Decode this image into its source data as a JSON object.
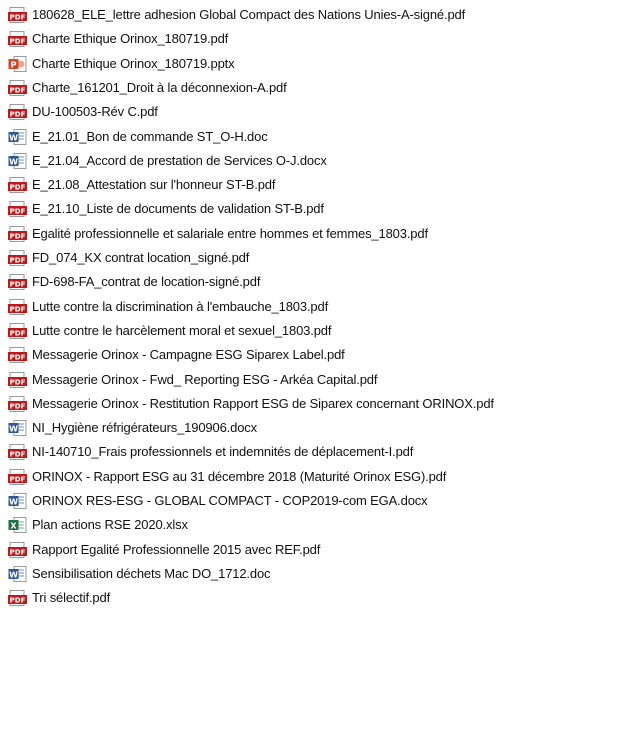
{
  "colors": {
    "pdf": "#b91c1c",
    "word": "#2b5797",
    "powerpoint": "#d24726",
    "excel": "#1d7044",
    "text": "#111111",
    "background": "#ffffff"
  },
  "files": [
    {
      "name": "180628_ELE_lettre adhesion Global Compact des Nations Unies-A-signé.pdf",
      "type": "pdf",
      "icon": "pdf-icon"
    },
    {
      "name": "Charte Ethique Orinox_180719.pdf",
      "type": "pdf",
      "icon": "pdf-icon"
    },
    {
      "name": "Charte Ethique Orinox_180719.pptx",
      "type": "pptx",
      "icon": "powerpoint-icon"
    },
    {
      "name": "Charte_161201_Droit à la déconnexion-A.pdf",
      "type": "pdf",
      "icon": "pdf-icon"
    },
    {
      "name": "DU-100503-Rév C.pdf",
      "type": "pdf",
      "icon": "pdf-icon"
    },
    {
      "name": "E_21.01_Bon de commande ST_O-H.doc",
      "type": "doc",
      "icon": "word-icon"
    },
    {
      "name": "E_21.04_Accord de prestation de Services O-J.docx",
      "type": "docx",
      "icon": "word-icon"
    },
    {
      "name": "E_21.08_Attestation sur l'honneur ST-B.pdf",
      "type": "pdf",
      "icon": "pdf-icon"
    },
    {
      "name": "E_21.10_Liste de  documents de validation ST-B.pdf",
      "type": "pdf",
      "icon": "pdf-icon"
    },
    {
      "name": "Egalité professionnelle et salariale entre hommes et femmes_1803.pdf",
      "type": "pdf",
      "icon": "pdf-icon"
    },
    {
      "name": "FD_074_KX contrat location_signé.pdf",
      "type": "pdf",
      "icon": "pdf-icon"
    },
    {
      "name": "FD-698-FA_contrat de location-signé.pdf",
      "type": "pdf",
      "icon": "pdf-icon"
    },
    {
      "name": "Lutte contre la discrimination à l'embauche_1803.pdf",
      "type": "pdf",
      "icon": "pdf-icon"
    },
    {
      "name": "Lutte contre le harcèlement moral et sexuel_1803.pdf",
      "type": "pdf",
      "icon": "pdf-icon"
    },
    {
      "name": "Messagerie Orinox - Campagne ESG Siparex Label.pdf",
      "type": "pdf",
      "icon": "pdf-icon"
    },
    {
      "name": "Messagerie Orinox - Fwd_ Reporting ESG - Arkéa Capital.pdf",
      "type": "pdf",
      "icon": "pdf-icon"
    },
    {
      "name": "Messagerie Orinox - Restitution Rapport ESG de Siparex concernant ORINOX.pdf",
      "type": "pdf",
      "icon": "pdf-icon"
    },
    {
      "name": "NI_Hygiène réfrigérateurs_190906.docx",
      "type": "docx",
      "icon": "word-icon"
    },
    {
      "name": "NI-140710_Frais professionnels et indemnités de déplacement-I.pdf",
      "type": "pdf",
      "icon": "pdf-icon"
    },
    {
      "name": "ORINOX - Rapport ESG au 31 décembre 2018 (Maturité Orinox ESG).pdf",
      "type": "pdf",
      "icon": "pdf-icon"
    },
    {
      "name": "ORINOX RES-ESG - GLOBAL COMPACT - COP2019-com EGA.docx",
      "type": "docx",
      "icon": "word-icon"
    },
    {
      "name": "Plan actions RSE 2020.xlsx",
      "type": "xlsx",
      "icon": "excel-icon"
    },
    {
      "name": "Rapport Egalité Professionnelle 2015 avec REF.pdf",
      "type": "pdf",
      "icon": "pdf-icon"
    },
    {
      "name": "Sensibilisation déchets Mac DO_1712.doc",
      "type": "doc",
      "icon": "word-icon"
    },
    {
      "name": "Tri sélectif.pdf",
      "type": "pdf",
      "icon": "pdf-icon"
    }
  ]
}
